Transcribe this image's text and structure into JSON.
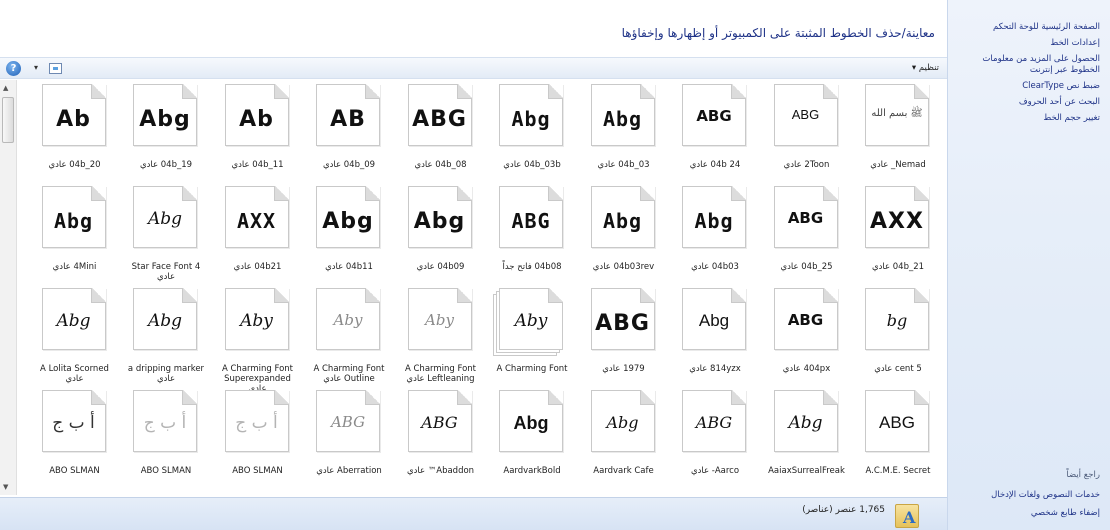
{
  "sidebar": {
    "home": "الصفحة الرئيسية للوحة التحكم",
    "links": [
      "إعدادات الخط",
      "الحصول على المزيد من معلومات الخطوط عبر إنترنت",
      "ضبط نص ClearType",
      "البحث عن أحد الحروف",
      "تغيير حجم الخط"
    ],
    "see_also": "راجع أيضاً",
    "see_also_links": [
      "خدمات النصوص ولغات الإدخال",
      "إضفاء طابع شخصي"
    ]
  },
  "header": {
    "title": "معاينة/حذف الخطوط المثبتة على الكمبيوتر أو إظهارها وإخفاؤها"
  },
  "toolbar": {
    "organize": "تنظيم ▾",
    "view_arrow": "▾",
    "help": "?"
  },
  "fonts": [
    {
      "glyph": "ﷺ بسم الله",
      "style": "g-tiny",
      "caption": "Nemad_ عادي"
    },
    {
      "glyph": "ABG",
      "style": "g-small",
      "caption": "2Toon عادي"
    },
    {
      "glyph": "ABG",
      "style": "g-mid",
      "caption": "04b 24 عادي"
    },
    {
      "glyph": "Abg",
      "style": "g-pixel",
      "caption": "04b_03 عادي"
    },
    {
      "glyph": "Abg",
      "style": "g-pixel",
      "caption": "04b_03b عادي"
    },
    {
      "glyph": "ABG",
      "style": "g-big",
      "caption": "04b_08 عادي"
    },
    {
      "glyph": "AB",
      "style": "g-big",
      "caption": "04b_09 عادي"
    },
    {
      "glyph": "Ab",
      "style": "g-big",
      "caption": "04b_11 عادي"
    },
    {
      "glyph": "Abg",
      "style": "g-big",
      "caption": "04b_19 عادي"
    },
    {
      "glyph": "Ab",
      "style": "g-big",
      "caption": "04b_20 عادي"
    },
    {
      "glyph": "AXX",
      "style": "g-big",
      "caption": "04b_21 عادي"
    },
    {
      "glyph": "ABG",
      "style": "g-mid",
      "caption": "04b_25 عادي"
    },
    {
      "glyph": "Abg",
      "style": "g-pixel",
      "caption": "04b03 عادي"
    },
    {
      "glyph": "Abg",
      "style": "g-pixel",
      "caption": "04b03rev عادي"
    },
    {
      "glyph": "ABG",
      "style": "g-pixel",
      "caption": "04b08 فاتح جداً"
    },
    {
      "glyph": "Abg",
      "style": "g-big",
      "caption": "04b09 عادي"
    },
    {
      "glyph": "Abg",
      "style": "g-big",
      "caption": "04b11 عادي"
    },
    {
      "glyph": "AXX",
      "style": "g-pixel",
      "caption": "04b21 عادي"
    },
    {
      "glyph": "Abg",
      "style": "g-script",
      "caption": "4 Star Face Font عادي"
    },
    {
      "glyph": "Abg",
      "style": "g-pixel",
      "caption": "4Mini عادي"
    },
    {
      "glyph": "bg",
      "style": "g-serif",
      "caption": "5 cent عادي"
    },
    {
      "glyph": "ABG",
      "style": "g-mid",
      "caption": "404px عادي"
    },
    {
      "glyph": "Abg",
      "style": "g-sans",
      "caption": "814yzx عادي"
    },
    {
      "glyph": "ABG",
      "style": "g-big",
      "caption": "1979 عادي"
    },
    {
      "glyph": "Aby",
      "style": "g-script",
      "caption": "A Charming Font",
      "stacked": true
    },
    {
      "glyph": "Aby",
      "style": "g-light",
      "caption": "A Charming Font Leftleaning عادي"
    },
    {
      "glyph": "Aby",
      "style": "g-light",
      "caption": "A Charming Font Outline عادي"
    },
    {
      "glyph": "Aby",
      "style": "g-script",
      "caption": "A Charming Font Superexpanded عادي"
    },
    {
      "glyph": "Abg",
      "style": "g-script",
      "caption": "a dripping marker عادي"
    },
    {
      "glyph": "Abg",
      "style": "g-script",
      "caption": "A Lolita Scorned عادي"
    },
    {
      "glyph": "ABG",
      "style": "g-sans",
      "caption": "A.C.M.E. Secret"
    },
    {
      "glyph": "Abg",
      "style": "g-script",
      "caption": "AaiaxSurrealFreak"
    },
    {
      "glyph": "ABG",
      "style": "g-serif",
      "caption": "Aarco- عادي"
    },
    {
      "glyph": "Abg",
      "style": "g-serif",
      "caption": "Aardvark Cafe"
    },
    {
      "glyph": "Abg",
      "style": "g-heavy",
      "caption": "AardvarkBold"
    },
    {
      "glyph": "ABG",
      "style": "g-serif",
      "caption": "Abaddon™ عادي"
    },
    {
      "glyph": "ABG",
      "style": "g-light",
      "caption": "Aberration عادي"
    },
    {
      "glyph": "أ ب ج",
      "style": "g-arabic-light",
      "caption": "ABO SLMAN"
    },
    {
      "glyph": "أ ب ج",
      "style": "g-arabic-light",
      "caption": "ABO SLMAN"
    },
    {
      "glyph": "أ ب ج",
      "style": "g-arabic",
      "caption": "ABO SLMAN"
    }
  ],
  "status": {
    "count": "1,765 عنصر (عناصر)",
    "folder_letter": "A"
  }
}
